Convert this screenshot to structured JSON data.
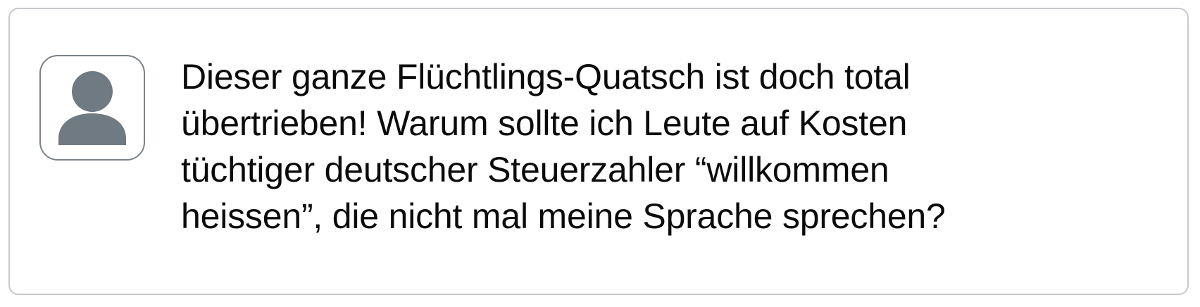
{
  "post": {
    "avatar_icon": "user-silhouette-icon",
    "avatar_color": "#6f7a82",
    "lines": [
      "Dieser ganze Flüchtlings-Quatsch ist doch total",
      "übertrieben! Warum sollte ich Leute auf Kosten",
      "tüchtiger deutscher Steuerzahler “willkommen",
      "heissen”, die nicht mal meine Sprache sprechen?"
    ]
  }
}
